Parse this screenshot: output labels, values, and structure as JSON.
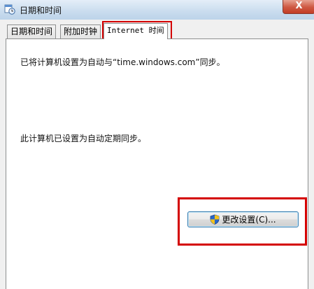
{
  "window": {
    "title": "日期和时间",
    "close_glyph": "X"
  },
  "tabs": [
    {
      "label": "日期和时间",
      "active": false
    },
    {
      "label": "附加时钟",
      "active": false
    },
    {
      "label": "Internet 时间",
      "active": true
    }
  ],
  "panel": {
    "sync_info": "已将计算机设置为自动与“time.windows.com”同步。",
    "schedule_info": "此计算机已设置为自动定期同步。",
    "change_settings_label": "更改设置(C)..."
  },
  "colors": {
    "highlight": "#d40000",
    "shield_blue": "#2a66c9",
    "shield_yellow": "#f3c21b"
  },
  "icons": {
    "app": "calendar-clock-icon",
    "button": "uac-shield-icon"
  }
}
